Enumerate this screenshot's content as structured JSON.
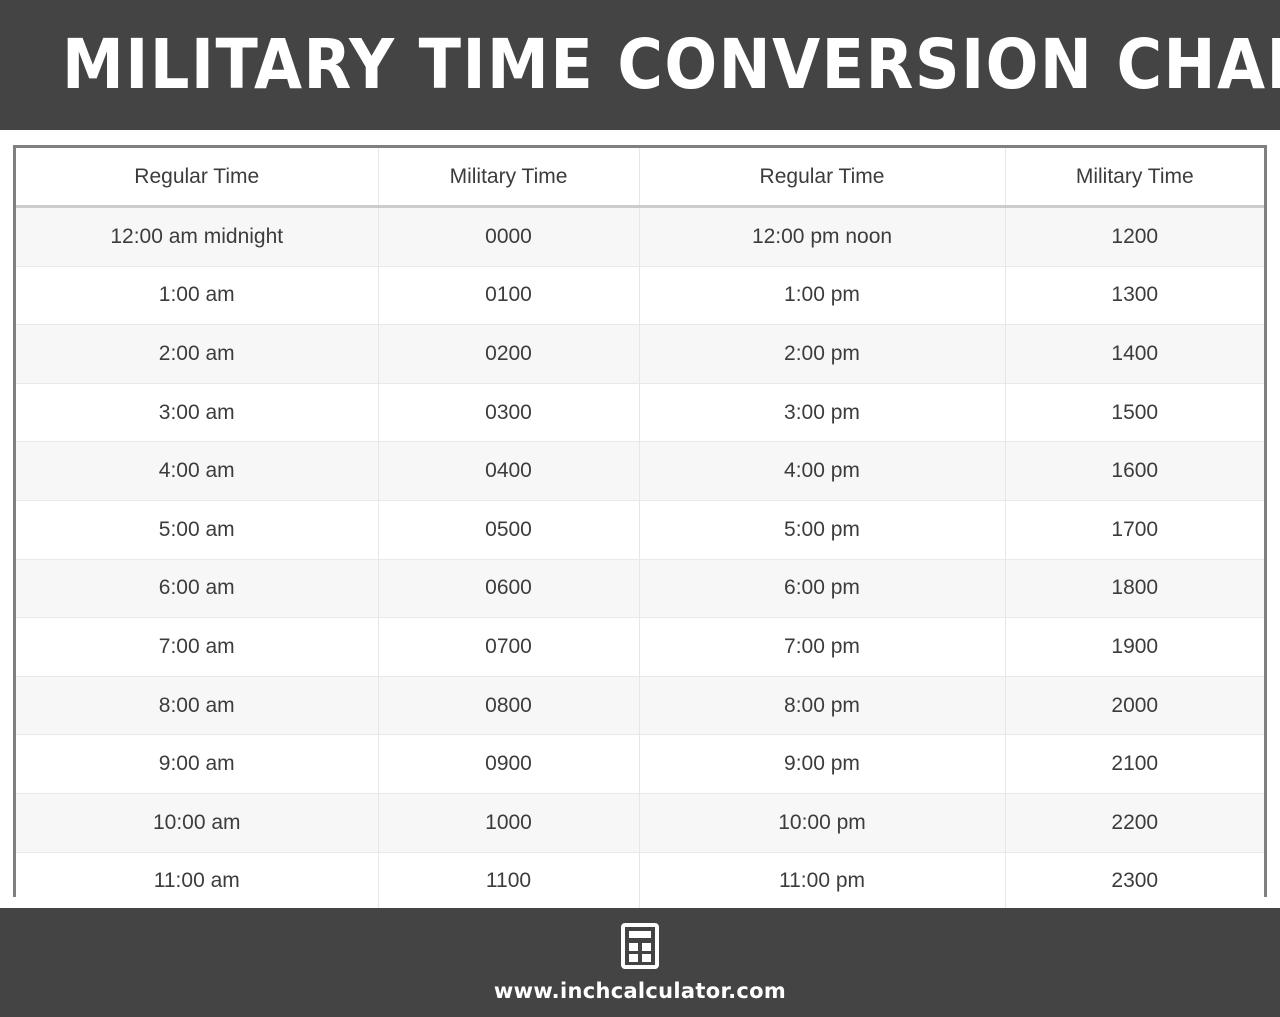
{
  "banner": {
    "title": "MILITARY TIME CONVERSION CHART",
    "background_color": "#444444",
    "text_color": "#ffffff"
  },
  "table": {
    "border_color": "#808080",
    "header_rule_color": "#cccccc",
    "stripe_color": "#f7f7f7",
    "text_color": "#3c3c3c",
    "headers": [
      "Regular Time",
      "Military Time",
      "Regular Time",
      "Military Time"
    ],
    "rows": [
      [
        "12:00 am midnight",
        "0000",
        "12:00 pm noon",
        "1200"
      ],
      [
        "1:00 am",
        "0100",
        "1:00 pm",
        "1300"
      ],
      [
        "2:00 am",
        "0200",
        "2:00 pm",
        "1400"
      ],
      [
        "3:00 am",
        "0300",
        "3:00 pm",
        "1500"
      ],
      [
        "4:00 am",
        "0400",
        "4:00 pm",
        "1600"
      ],
      [
        "5:00 am",
        "0500",
        "5:00 pm",
        "1700"
      ],
      [
        "6:00 am",
        "0600",
        "6:00 pm",
        "1800"
      ],
      [
        "7:00 am",
        "0700",
        "7:00 pm",
        "1900"
      ],
      [
        "8:00 am",
        "0800",
        "8:00 pm",
        "2000"
      ],
      [
        "9:00 am",
        "0900",
        "9:00 pm",
        "2100"
      ],
      [
        "10:00 am",
        "1000",
        "10:00 pm",
        "2200"
      ],
      [
        "11:00 am",
        "1100",
        "11:00 pm",
        "2300"
      ]
    ]
  },
  "footer": {
    "logo_icon": "calculator-icon",
    "url": "www.inchcalculator.com",
    "background_color": "#444444",
    "text_color": "#ffffff"
  }
}
